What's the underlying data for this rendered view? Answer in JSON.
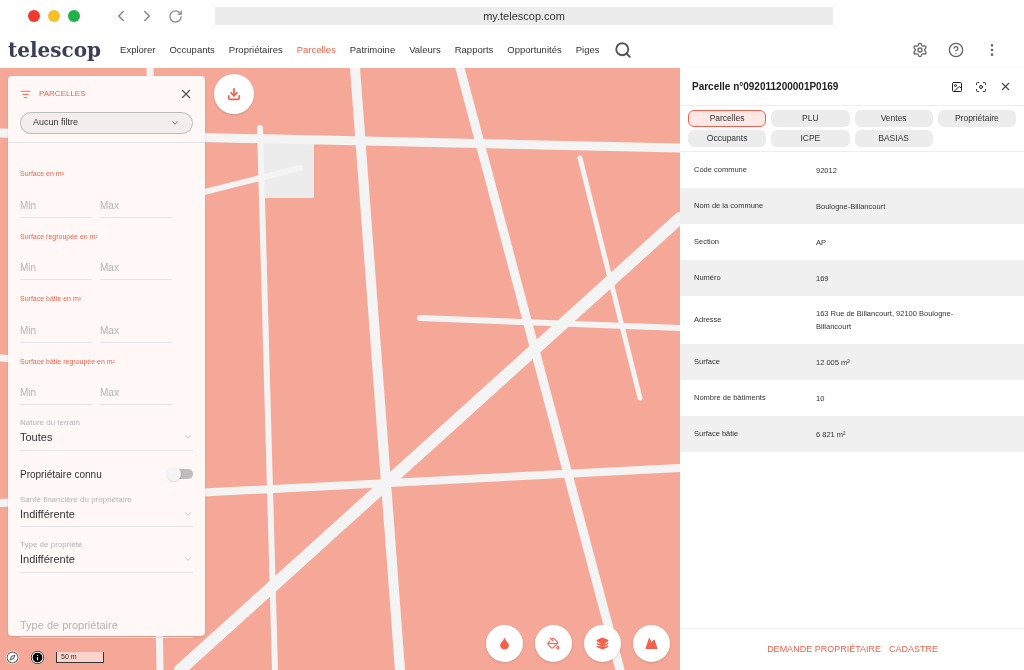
{
  "browser": {
    "url": "my.telescop.com"
  },
  "nav": {
    "logo": "telescop",
    "items": [
      {
        "label": "Explorer",
        "selected": false
      },
      {
        "label": "Occupants",
        "selected": false
      },
      {
        "label": "Propriétaires",
        "selected": false
      },
      {
        "label": "Parcelles",
        "selected": true
      },
      {
        "label": "Patrimoine",
        "selected": false
      },
      {
        "label": "Valeurs",
        "selected": false
      },
      {
        "label": "Rapports",
        "selected": false
      },
      {
        "label": "Opportunités",
        "selected": false
      },
      {
        "label": "Piges",
        "selected": false
      }
    ]
  },
  "filter_panel": {
    "title": "PARCELLES",
    "preset": "Aucun filtre",
    "ranges": [
      {
        "label": "Surface en m²",
        "min_placeholder": "Min",
        "max_placeholder": "Max"
      },
      {
        "label": "Surface regroupée en m²",
        "min_placeholder": "Min",
        "max_placeholder": "Max"
      },
      {
        "label": "Surface bâtie en m²",
        "min_placeholder": "Min",
        "max_placeholder": "Max"
      },
      {
        "label": "Surface bâtie regroupée en m²",
        "min_placeholder": "Min",
        "max_placeholder": "Max"
      }
    ],
    "controls": [
      {
        "kind": "select",
        "label": "Nature du terrain",
        "value": "Toutes"
      },
      {
        "kind": "toggle",
        "label": "Propriétaire connu",
        "on": false
      },
      {
        "kind": "select",
        "label": "Santé financière du propriétaire",
        "value": "Indifférente"
      },
      {
        "kind": "select",
        "label": "Type de propriété",
        "value": "Indifférente"
      },
      {
        "kind": "text",
        "placeholder": "Type de propriétaire"
      }
    ]
  },
  "map": {
    "scale": "50 m"
  },
  "detail": {
    "title": "Parcelle n°092011200001P0169",
    "tabs": [
      {
        "label": "Parcelles",
        "selected": true
      },
      {
        "label": "PLU",
        "selected": false
      },
      {
        "label": "Ventes",
        "selected": false
      },
      {
        "label": "Propriétaire",
        "selected": false
      },
      {
        "label": "Occupants",
        "selected": false
      },
      {
        "label": "ICPE",
        "selected": false
      },
      {
        "label": "BASIAS",
        "selected": false
      }
    ],
    "rows": [
      {
        "label": "Code commune",
        "value": "92012"
      },
      {
        "label": "Nom de la commune",
        "value": "Boulogne-Billancourt"
      },
      {
        "label": "Section",
        "value": "AP"
      },
      {
        "label": "Numéro",
        "value": "169"
      },
      {
        "label": "Adresse",
        "value": "163 Rue de Billancourt, 92100 Boulogne-Billancourt"
      },
      {
        "label": "Surface",
        "value": "12 005 m²"
      },
      {
        "label": "Nombre de bâtiments",
        "value": "10"
      },
      {
        "label": "Surface bâtie",
        "value": "6 821 m²"
      }
    ],
    "actions": [
      "DEMANDE PROPRIÉTAIRE",
      "CADASTRE"
    ]
  }
}
